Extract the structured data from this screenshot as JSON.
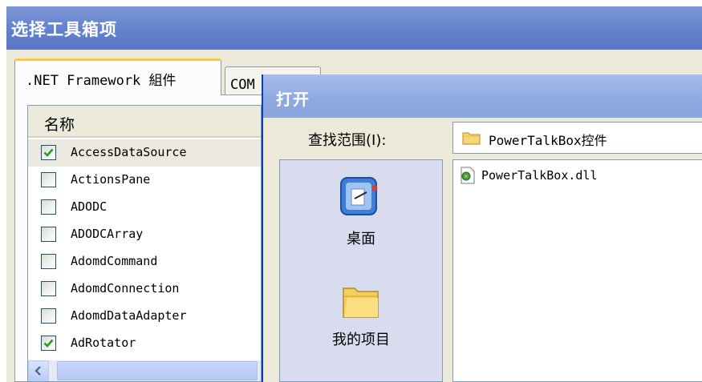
{
  "toolbox_dialog": {
    "title": "选择工具箱项",
    "tabs": [
      {
        "label": ".NET Framework 組件",
        "active": true
      },
      {
        "label": "COM 组件",
        "active": false
      }
    ],
    "list": {
      "column_header": "名称",
      "items": [
        {
          "label": "AccessDataSource",
          "checked": true
        },
        {
          "label": "ActionsPane",
          "checked": false
        },
        {
          "label": "ADODC",
          "checked": false
        },
        {
          "label": "ADODCArray",
          "checked": false
        },
        {
          "label": "AdomdCommand",
          "checked": false
        },
        {
          "label": "AdomdConnection",
          "checked": false
        },
        {
          "label": "AdomdDataAdapter",
          "checked": false
        },
        {
          "label": "AdRotator",
          "checked": true
        }
      ]
    }
  },
  "open_dialog": {
    "title": "打开",
    "look_in_label": "查找范围(I):",
    "look_in_value": "PowerTalkBox控件",
    "places": [
      {
        "label": "桌面",
        "icon": "desktop-icon"
      },
      {
        "label": "我的项目",
        "icon": "folder-icon"
      }
    ],
    "files": [
      {
        "name": "PowerTalkBox.dll",
        "icon": "dll-file-icon"
      }
    ]
  },
  "colors": {
    "title_bar": "#6281cd",
    "title_bar_inactive": "#8ea9e0",
    "dialog_bg": "#ece9d8",
    "active_tab_highlight": "#ffc83c",
    "checkmark": "#21a121"
  }
}
